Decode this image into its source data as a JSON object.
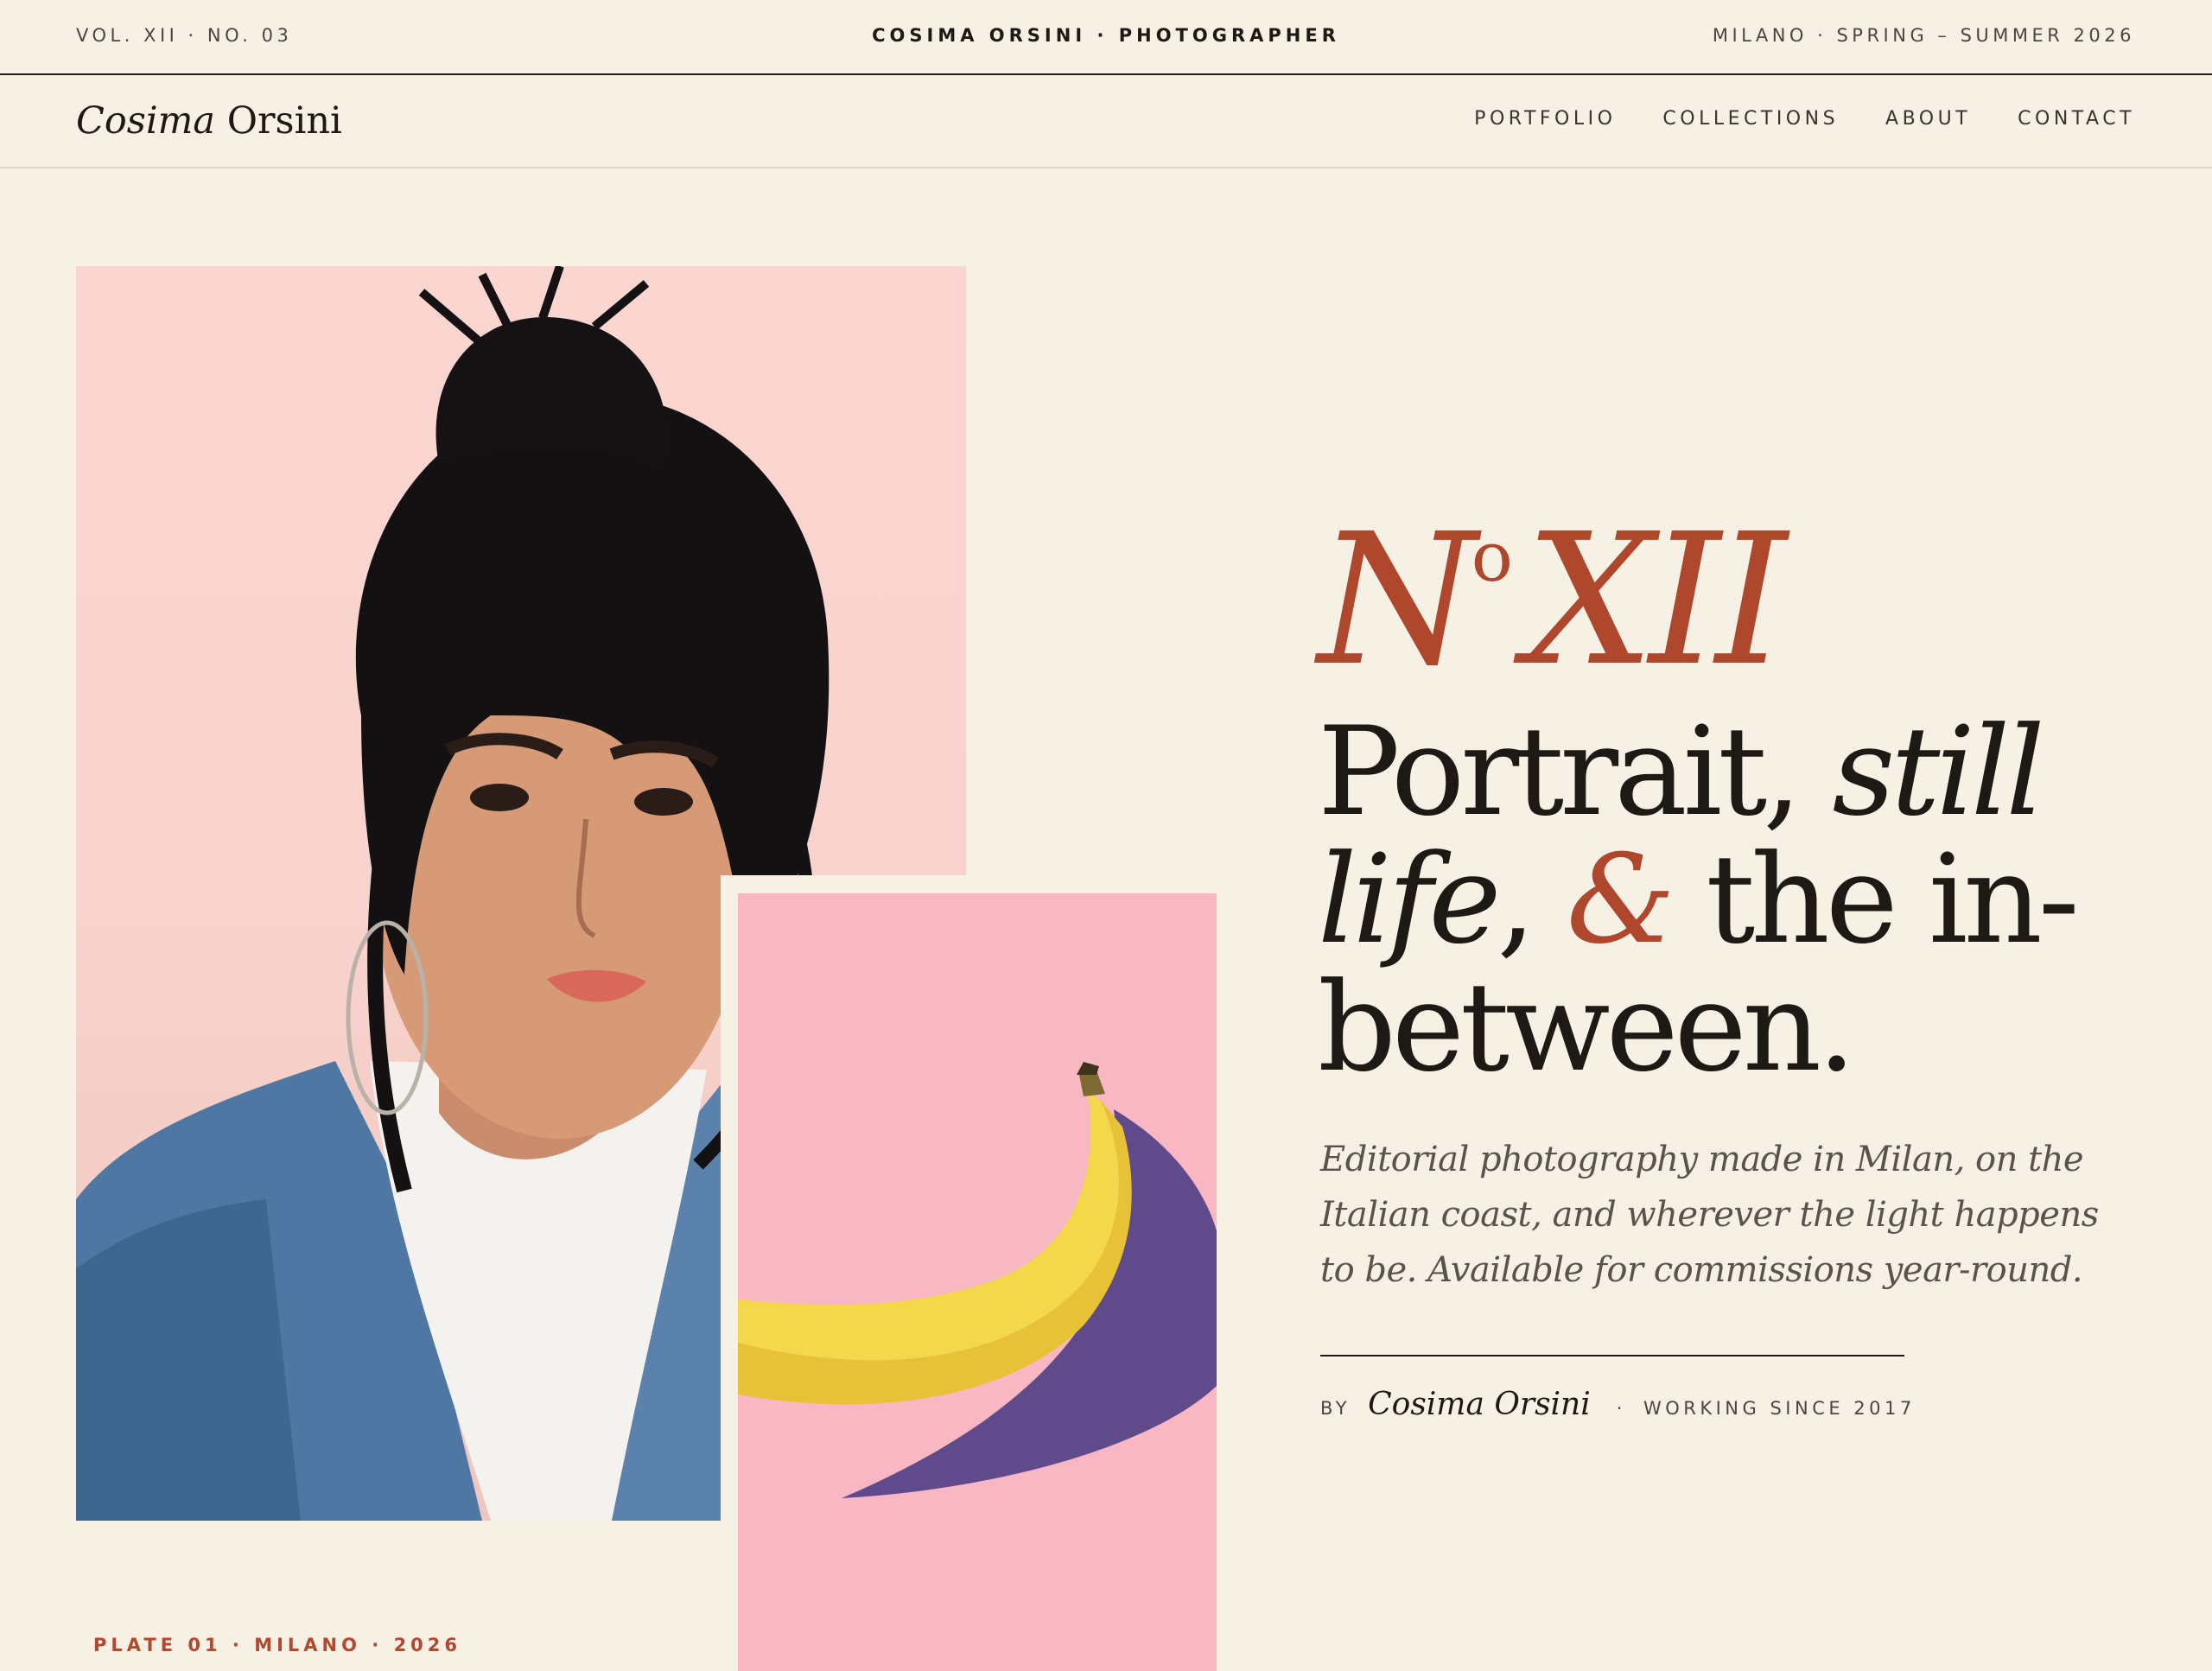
{
  "topbar": {
    "issue": "VOL. XII · NO. 03",
    "center": "COSIMA ORSINI · PHOTOGRAPHER",
    "season": "MILANO · SPRING – SUMMER 2026"
  },
  "brand": {
    "first": "Cosima",
    "last": "Orsini"
  },
  "nav": [
    "PORTFOLIO",
    "COLLECTIONS",
    "ABOUT",
    "CONTACT"
  ],
  "hero": {
    "issue_prefix": "N",
    "issue_sup": "o",
    "issue_number": "XII",
    "headline": {
      "part1": "Portrait, ",
      "still": "still",
      "life": "life",
      "comma": ", ",
      "amp": "&",
      "part2": " the in-",
      "part3": "between."
    },
    "lede": "Editorial photography made in Milan, on the Italian coast, and wherever the light happens to be. Available for commissions year-round.",
    "byline": {
      "by": "BY",
      "author": "Cosima Orsini",
      "dot": "·",
      "since": "WORKING SINCE 2017"
    }
  },
  "plate": "PLATE 01 · MILANO · 2026",
  "colors": {
    "background": "#f6f0e5",
    "ink": "#1d1914",
    "accent": "#ae472c",
    "portrait_bg": "#fbd5cf",
    "still_bg": "#f9b6c3"
  }
}
